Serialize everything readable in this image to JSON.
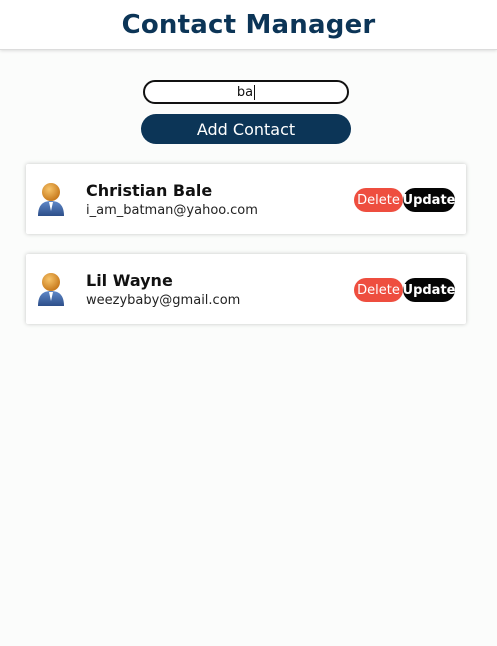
{
  "header": {
    "title": "Contact Manager"
  },
  "search": {
    "value": "ba"
  },
  "add_button_label": "Add Contact",
  "contacts": [
    {
      "name": "Christian Bale",
      "email": "i_am_batman@yahoo.com",
      "avatar_icon": "user-avatar-icon",
      "delete_label": "Delete",
      "update_label": "Update"
    },
    {
      "name": "Lil Wayne",
      "email": "weezybaby@gmail.com",
      "avatar_icon": "user-avatar-icon",
      "delete_label": "Delete",
      "update_label": "Update"
    }
  ],
  "colors": {
    "primary": "#0c3557",
    "delete": "#ee4e3f",
    "update": "#050505"
  }
}
